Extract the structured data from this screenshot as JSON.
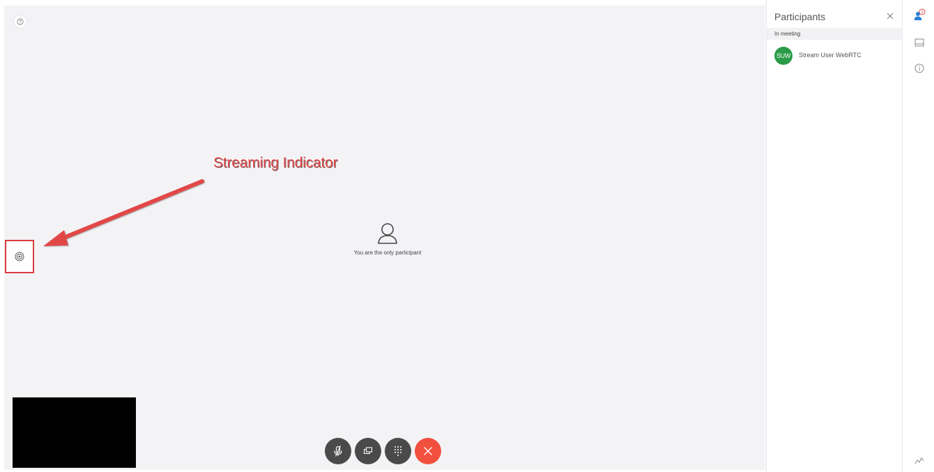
{
  "stage": {
    "annotation_label": "Streaming Indicator",
    "empty_message": "You are the only participant"
  },
  "participants_panel": {
    "title": "Participants",
    "section_label": "In meeting",
    "participants": [
      {
        "initials": "SUW",
        "name": "Stream User WebRTC",
        "avatar_color": "#2a9b48"
      }
    ]
  },
  "controls": {
    "end_color": "#f2503e",
    "button_color": "#4a4a4a"
  },
  "rail": {
    "participants_badge": "1"
  },
  "colors": {
    "annotation": "#e24646",
    "stage_background": "#f3f3f6"
  }
}
